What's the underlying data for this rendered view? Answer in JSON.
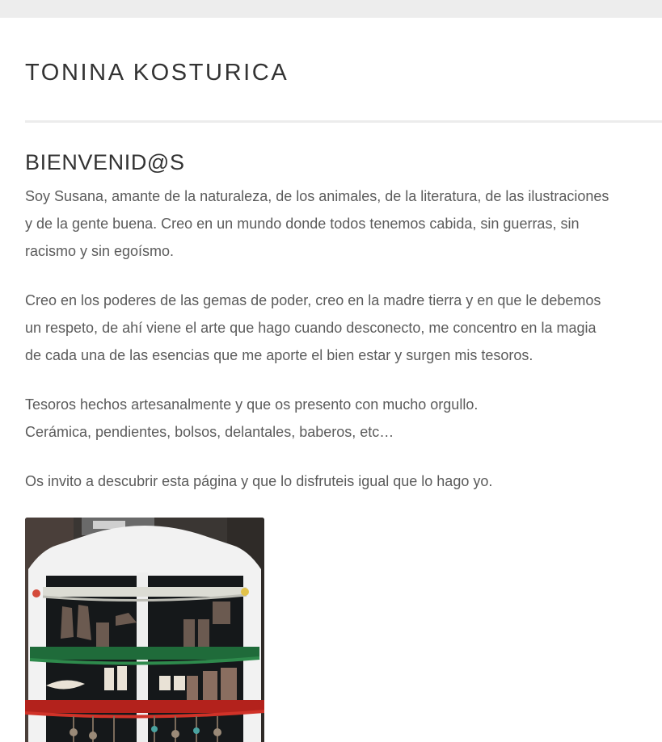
{
  "site": {
    "title": "TONINA KOSTURICA"
  },
  "page": {
    "heading": "BIENVENID@S",
    "paragraphs": [
      [
        "Soy Susana, amante de la naturaleza, de los animales, de la literatura, de las ilustraciones",
        "y de la gente buena. Creo en un mundo donde todos tenemos cabida, sin guerras, sin",
        "racismo y sin egoísmo."
      ],
      [
        "Creo en los poderes de las gemas de poder, creo en la madre tierra y en que le debemos",
        "un respeto, de ahí viene el arte que hago cuando desconecto, me concentro en la magia",
        "de cada una de las esencias que me aporte el bien estar y surgen mis tesoros."
      ],
      [
        "Tesoros hechos artesanalmente y que os presento con mucho orgullo.",
        "Cerámica, pendientes, bolsos, delantales, baberos, etc…"
      ],
      [
        "Os invito a descubrir esta página y que lo disfruteis igual que lo hago yo."
      ]
    ],
    "photo_alt": "Handmade earrings displayed on a white wooden frame"
  },
  "colors": {
    "topbar": "#ededed",
    "title": "#333333",
    "body_text": "#5b5b5b",
    "divider": "#ececec"
  }
}
